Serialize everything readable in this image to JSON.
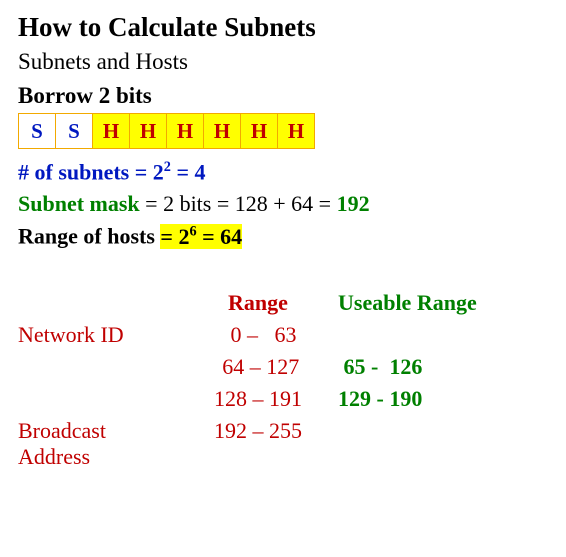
{
  "title": "How to Calculate Subnets",
  "subtitle": "Subnets and Hosts",
  "borrow_label": "Borrow 2 bits",
  "bits": [
    "S",
    "S",
    "H",
    "H",
    "H",
    "H",
    "H",
    "H"
  ],
  "line1": {
    "prefix": "# of subnets = 2",
    "exp": "2",
    "suffix": " = 4"
  },
  "line2": {
    "label": "Subnet mask",
    "rest": " = 2 bits = 128 + 64 = ",
    "result": "192"
  },
  "line3": {
    "label": "Range of hosts ",
    "eq1": "= 2",
    "exp": "6",
    "eq2": " = 64"
  },
  "table": {
    "range_hdr": "Range",
    "use_hdr": "Useable Range",
    "labels": {
      "network": "Network ID",
      "broadcast": "Broadcast\nAddress"
    },
    "rows": [
      {
        "range": "  0 –   63",
        "use": ""
      },
      {
        "range": " 64 – 127",
        "use": " 65 -  126"
      },
      {
        "range": "128 – 191",
        "use": "129 - 190"
      },
      {
        "range": "192 – 255",
        "use": ""
      }
    ]
  }
}
